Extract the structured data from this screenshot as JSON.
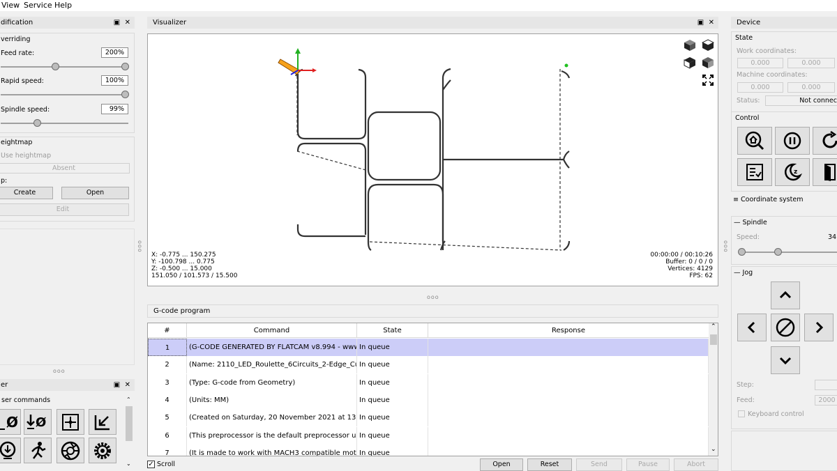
{
  "menu": {
    "view": "View",
    "service": "Service",
    "help": "Help"
  },
  "modification": {
    "title": "dification",
    "overriding": "verriding",
    "feed_rate_label": "Feed rate:",
    "feed_rate_value": "200%",
    "feed_rate_level": 1.0,
    "rapid_speed_label": "Rapid speed:",
    "rapid_speed_value": "100%",
    "rapid_speed_level": 1.0,
    "spindle_speed_label": "Spindle speed:",
    "spindle_speed_value": "99%",
    "spindle_speed_level": 0.3
  },
  "heightmap": {
    "title": "eightmap",
    "use_label": "Use heightmap",
    "status": "Absent",
    "map_label": "p:",
    "create": "Create",
    "open": "Open",
    "edit": "Edit"
  },
  "user_commands": {
    "title": "er",
    "label": "ser commands"
  },
  "visualizer": {
    "title": "Visualizer",
    "info_left": [
      "X: -0.775 ... 150.275",
      "Y: -100.798 ... 0.775",
      "Z: -0.500 ... 15.000",
      "151.050 / 101.573 / 15.500"
    ],
    "info_right": [
      "00:00:00 / 00:10:26",
      "Buffer: 0 / 0 / 0",
      "Vertices: 4129",
      "FPS: 62"
    ]
  },
  "gcode": {
    "title": "G-code program",
    "columns": [
      "#",
      "Command",
      "State",
      "Response"
    ],
    "rows": [
      {
        "n": "1",
        "cmd": "(G-CODE GENERATED BY FLATCAM v8.994 - www....",
        "state": "In queue",
        "resp": ""
      },
      {
        "n": "2",
        "cmd": "(Name: 2110_LED_Roulette_6Circuits_2-Edge_Cuts...",
        "state": "In queue",
        "resp": ""
      },
      {
        "n": "3",
        "cmd": "(Type: G-code from Geometry)",
        "state": "In queue",
        "resp": ""
      },
      {
        "n": "4",
        "cmd": "(Units: MM)",
        "state": "In queue",
        "resp": ""
      },
      {
        "n": "5",
        "cmd": "(Created on Saturday, 20 November 2021 at 13:54)",
        "state": "In queue",
        "resp": ""
      },
      {
        "n": "6",
        "cmd": "(This preprocessor is the default preprocessor used...",
        "state": "In queue",
        "resp": ""
      },
      {
        "n": "7",
        "cmd": "(It is made to work with MACH3 compatible motio...",
        "state": "In queue",
        "resp": ""
      }
    ],
    "scroll": "Scroll",
    "buttons": {
      "open": "Open",
      "reset": "Reset",
      "send": "Send",
      "pause": "Pause",
      "abort": "Abort"
    }
  },
  "device": {
    "title": "Device",
    "state_label": "State",
    "work_coords_label": "Work coordinates:",
    "work_x": "0.000",
    "work_y": "0.000",
    "machine_coords_label": "Machine coordinates:",
    "machine_x": "0.000",
    "machine_y": "0.000",
    "status_label": "Status:",
    "status_value": "Not connec",
    "control_label": "Control",
    "coord_system": "Coordinate system",
    "spindle_label": "Spindle",
    "speed_label": "Speed:",
    "speed_value": "34",
    "jog_label": "Jog",
    "step_label": "Step:",
    "feed_label": "Feed:",
    "feed_value": "2000",
    "keyboard_control": "Keyboard control"
  }
}
